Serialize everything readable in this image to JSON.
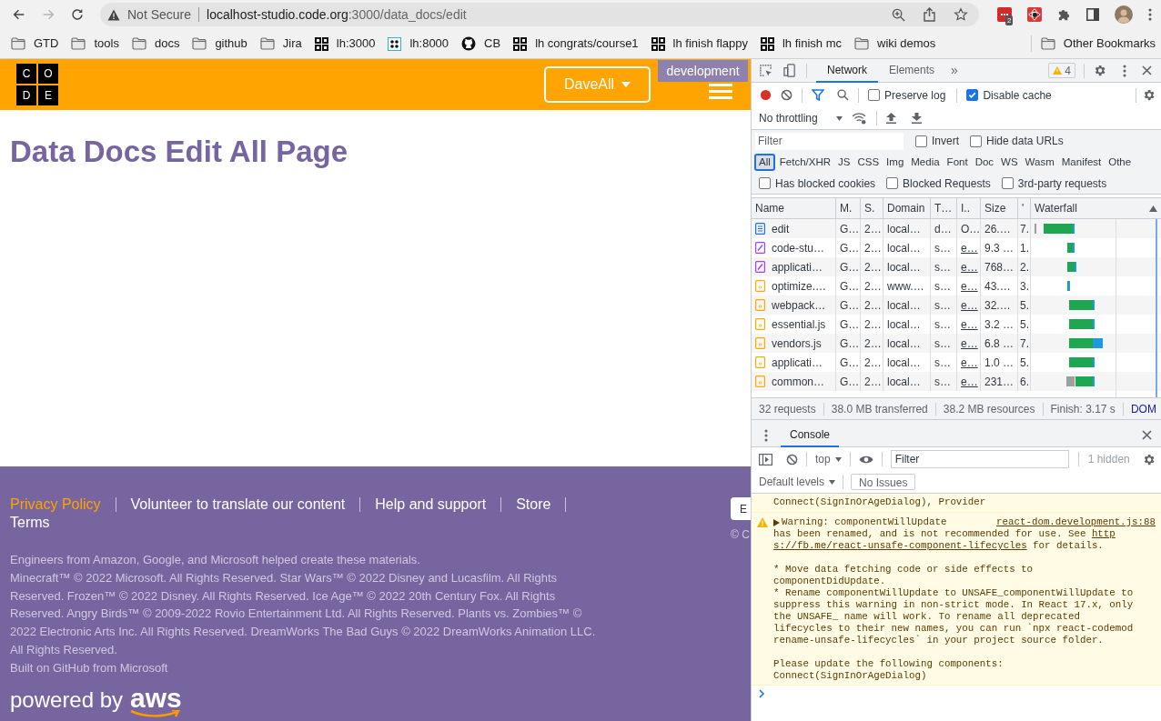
{
  "browser": {
    "forward_disabled": true,
    "address_bar": {
      "security": "Not Secure",
      "host": "localhost-studio.code.org",
      "path": ":3000/data_docs/edit"
    },
    "extension_badge": "2",
    "bookmarks": [
      {
        "label": "GTD",
        "kind": "folder"
      },
      {
        "label": "tools",
        "kind": "folder"
      },
      {
        "label": "docs",
        "kind": "folder"
      },
      {
        "label": "github",
        "kind": "folder"
      },
      {
        "label": "Jira",
        "kind": "folder"
      },
      {
        "label": "lh:3000",
        "kind": "grid"
      },
      {
        "label": "lh:8000",
        "kind": "dots"
      },
      {
        "label": "CB",
        "kind": "round"
      },
      {
        "label": "lh congrats/course1",
        "kind": "grid"
      },
      {
        "label": "lh finish flappy",
        "kind": "grid"
      },
      {
        "label": "lh finish mc",
        "kind": "grid"
      },
      {
        "label": "wiki demos",
        "kind": "folder"
      }
    ],
    "other_bookmarks": "Other Bookmarks"
  },
  "page": {
    "logo": [
      "C",
      "O",
      "D",
      "E"
    ],
    "user_menu": "DaveAll",
    "environment_badge": "development",
    "title": "Data Docs Edit All Page",
    "footer": {
      "links": [
        {
          "label": "Privacy Policy",
          "highlighted": true
        },
        {
          "label": "Volunteer to translate our content",
          "highlighted": false
        },
        {
          "label": "Help and support",
          "highlighted": false
        },
        {
          "label": "Store",
          "highlighted": false
        },
        {
          "label": "Terms",
          "highlighted": false
        }
      ],
      "language_select": "E",
      "copyright_cut": "© C",
      "paragraphs": [
        "Engineers from Amazon, Google, and Microsoft helped create these materials.",
        "Minecraft™ © 2022 Microsoft. All Rights Reserved. Star Wars™ © 2022 Disney and Lucasfilm. All Rights Reserved. Frozen™ © 2022 Disney. All Rights Reserved. Ice Age™ © 2022 20th Century Fox. All Rights Reserved. Angry Birds™ © 2009-2022 Rovio Entertainment Ltd. All Rights Reserved. Plants vs. Zombies™ © 2022 Electronic Arts Inc. All Rights Reserved. DreamWorks The Bad Guys © 2022 DreamWorks Animation LLC. All Rights Reserved.",
        "Built on GitHub from Microsoft"
      ],
      "powered_by": "powered by",
      "aws": "aws"
    }
  },
  "devtools": {
    "tabs": [
      {
        "label": "Network",
        "selected": true
      },
      {
        "label": "Elements",
        "selected": false
      }
    ],
    "more_tabs": "»",
    "warnings": "4",
    "network": {
      "options": [
        {
          "label": "Preserve log",
          "checked": false
        },
        {
          "label": "Disable cache",
          "checked": true
        }
      ],
      "throttling": "No throttling",
      "filter_placeholder": "Filter",
      "filter_options": [
        {
          "label": "Invert",
          "checked": false
        },
        {
          "label": "Hide data URLs",
          "checked": false
        }
      ],
      "type_filters": [
        {
          "label": "All",
          "selected": true
        },
        {
          "label": "Fetch/XHR",
          "selected": false
        },
        {
          "label": "JS",
          "selected": false
        },
        {
          "label": "CSS",
          "selected": false
        },
        {
          "label": "Img",
          "selected": false
        },
        {
          "label": "Media",
          "selected": false
        },
        {
          "label": "Font",
          "selected": false
        },
        {
          "label": "Doc",
          "selected": false
        },
        {
          "label": "WS",
          "selected": false
        },
        {
          "label": "Wasm",
          "selected": false
        },
        {
          "label": "Manifest",
          "selected": false
        },
        {
          "label": "Othe",
          "selected": false
        }
      ],
      "extra_filters": [
        {
          "label": "Has blocked cookies",
          "checked": false
        },
        {
          "label": "Blocked Requests",
          "checked": false
        },
        {
          "label": "3rd-party requests",
          "checked": false
        }
      ],
      "columns": [
        "Name",
        "M.",
        "S.",
        "Domain",
        "T…",
        "I..",
        "Size",
        "'",
        "Waterfall"
      ],
      "rows": [
        {
          "kind": "document",
          "initiator_link": false,
          "cells": [
            "edit",
            "G…",
            "2…",
            "local…",
            "d…",
            "O…",
            "26.…",
            "7."
          ]
        },
        {
          "kind": "stylesheet",
          "initiator_link": true,
          "cells": [
            "code-stu…",
            "G…",
            "2…",
            "local…",
            "s…",
            "e…",
            "9.3 …",
            "1."
          ]
        },
        {
          "kind": "stylesheet",
          "initiator_link": true,
          "cells": [
            "applicati…",
            "G…",
            "2…",
            "local…",
            "s…",
            "e…",
            "768…",
            "2."
          ]
        },
        {
          "kind": "script",
          "initiator_link": true,
          "cells": [
            "optimize.…",
            "G…",
            "2…",
            "www.…",
            "s…",
            "e…",
            "43.…",
            "3."
          ]
        },
        {
          "kind": "script",
          "initiator_link": true,
          "cells": [
            "webpack…",
            "G…",
            "2…",
            "local…",
            "s…",
            "e…",
            "32.…",
            "5."
          ]
        },
        {
          "kind": "script",
          "initiator_link": true,
          "cells": [
            "essential.js",
            "G…",
            "2…",
            "local…",
            "s…",
            "e…",
            "3.2 …",
            "5."
          ]
        },
        {
          "kind": "script",
          "initiator_link": true,
          "cells": [
            "vendors.js",
            "G…",
            "2…",
            "local…",
            "s…",
            "e…",
            "6.8 …",
            "7."
          ]
        },
        {
          "kind": "script",
          "initiator_link": true,
          "cells": [
            "applicati…",
            "G…",
            "2…",
            "local…",
            "s…",
            "e…",
            "1.0 …",
            "5."
          ]
        },
        {
          "kind": "script",
          "initiator_link": true,
          "cells": [
            "common…",
            "G…",
            "2…",
            "local…",
            "s…",
            "e…",
            "231…",
            "6."
          ]
        }
      ],
      "status_bar": [
        {
          "text": "32 requests",
          "highlighted": false
        },
        {
          "text": "38.0 MB transferred",
          "highlighted": false
        },
        {
          "text": "38.2 MB resources",
          "highlighted": false
        },
        {
          "text": "Finish: 3.17 s",
          "highlighted": false
        },
        {
          "text": "DOM",
          "highlighted": true
        }
      ]
    },
    "console": {
      "tab": {
        "label": "Console",
        "selected": true
      },
      "context": "top",
      "filter_placeholder": "Filter",
      "hidden": "1 hidden",
      "levels": "Default levels",
      "issues": "No Issues",
      "messages": [
        {
          "kind": "continuation",
          "paragraphs": [
            [
              "Connect(SignInOrAgeDialog), Provider"
            ]
          ]
        },
        {
          "kind": "warning",
          "expanded": false,
          "heading": "Warning: componentWillUpdate",
          "source": "react-dom.development.js:88",
          "paragraphs": [
            [
              [
                {
                  "text": "has been renamed, and is not recommended for use. See ",
                  "link": false
                },
                {
                  "text": "http",
                  "link": true
                }
              ],
              [
                {
                  "text": "s://fb.me/react-unsafe-component-lifecycles",
                  "link": true
                },
                {
                  "text": " for details.",
                  "link": false
                }
              ]
            ],
            [
              "* Move data fetching code or side effects to",
              "componentDidUpdate.",
              "* Rename componentWillUpdate to UNSAFE_componentWillUpdate to",
              "suppress this warning in non-strict mode. In React 17.x, only",
              "the UNSAFE_ name will work. To rename all deprecated",
              "lifecycles to their new names, you can run `npx react-codemod",
              "rename-unsafe-lifecycles` in your project source folder."
            ],
            [
              "Please update the following components:",
              "Connect(SignInOrAgeDialog)"
            ]
          ]
        }
      ]
    }
  }
}
